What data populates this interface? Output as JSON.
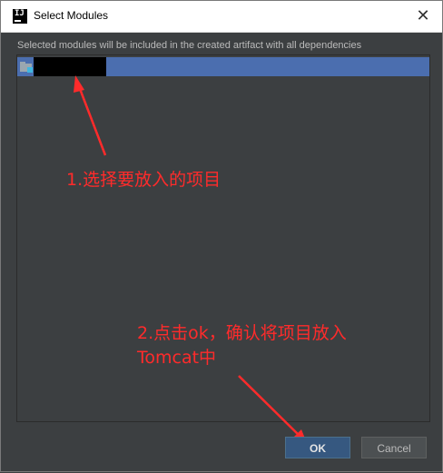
{
  "window": {
    "title": "Select Modules",
    "close_glyph": "✕",
    "app_icon": "intellij-icon"
  },
  "description": "Selected modules will be included in the created artifact with all dependencies",
  "modules": [
    {
      "name": "",
      "icon": "module-folder-icon",
      "selected": true
    }
  ],
  "annotations": {
    "step1": "1.选择要放入的项目",
    "step2_line1": "2.点击ok，确认将项目放入",
    "step2_line2": "Tomcat中",
    "color": "#ff2b2b"
  },
  "buttons": {
    "ok": "OK",
    "cancel": "Cancel"
  },
  "colors": {
    "background": "#3c3f41",
    "selection": "#4b6eaf",
    "ok_button": "#365880"
  }
}
